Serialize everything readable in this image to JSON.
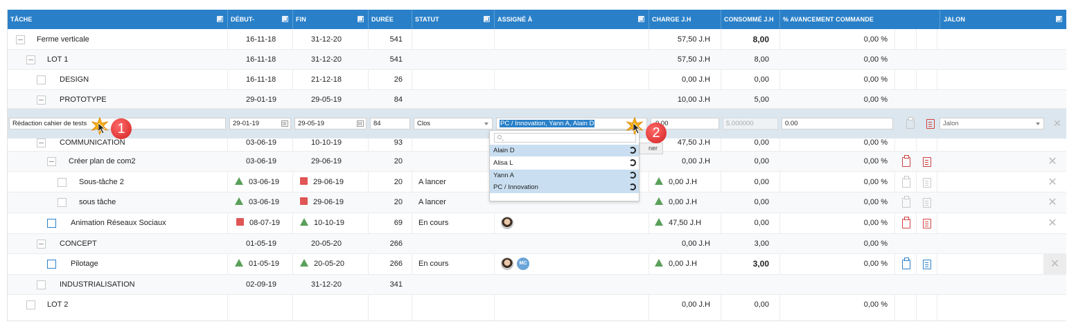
{
  "columns": {
    "task": "TÂCHE",
    "start": "DÉBUT-",
    "end": "FIN",
    "duration": "DURÉE",
    "status": "STATUT",
    "assigned": "ASSIGNÉ À",
    "charge": "CHARGE J.H",
    "consumed": "CONSOMMÉ J.H",
    "progress": "% AVANCEMENT COMMANDE",
    "milestone": "JALON"
  },
  "rows_top": [
    {
      "task": "Ferme verticale",
      "start": "16-11-18",
      "end": "31-12-20",
      "duration": "541",
      "charge": "57,50 J.H",
      "consumed": "8,00",
      "progress": "0,00 %"
    },
    {
      "task": "LOT 1",
      "start": "16-11-18",
      "end": "31-12-20",
      "duration": "541",
      "charge": "57,50 J.H",
      "consumed": "8,00",
      "progress": "0,00 %"
    },
    {
      "task": "DESIGN",
      "start": "16-11-18",
      "end": "21-12-18",
      "duration": "26",
      "charge": "0,00 J.H",
      "consumed": "0,00",
      "progress": "0,00 %"
    },
    {
      "task": "PROTOTYPE",
      "start": "29-01-19",
      "end": "29-05-19",
      "duration": "84",
      "charge": "10,00 J.H",
      "consumed": "5,00",
      "progress": "0,00 %"
    }
  ],
  "edit_row": {
    "task": "Rédaction cahier de tests",
    "start": "29-01-19",
    "end": "29-05-19",
    "duration": "84",
    "status": "Clos",
    "assigned": "PC / Innovation, Yann A, Alain D",
    "charge": "0,00",
    "consumed": "5.000000",
    "progress": "0.00",
    "milestone": "Jalon"
  },
  "rows_bottom": [
    {
      "task": "COMMUNICATION",
      "start": "03-06-19",
      "end": "10-10-19",
      "duration": "93",
      "status": "",
      "charge": "47,50 J.H",
      "consumed": "0,00",
      "progress": "0,00 %"
    },
    {
      "task": "Créer plan de com2",
      "start": "03-06-19",
      "end": "29-06-19",
      "duration": "20",
      "status": "",
      "charge": "0,00 J.H",
      "consumed": "0,00",
      "progress": "0,00 %"
    },
    {
      "task": "Sous-tâche 2",
      "start": "03-06-19",
      "end": "29-06-19",
      "duration": "20",
      "status": "A lancer",
      "charge": "0,00 J.H",
      "consumed": "0,00",
      "progress": "0,00 %"
    },
    {
      "task": "sous tâche",
      "start": "03-06-19",
      "end": "29-06-19",
      "duration": "20",
      "status": "A lancer",
      "charge": "0,00 J.H",
      "consumed": "0,00",
      "progress": "0,00 %"
    },
    {
      "task": "Animation Réseaux Sociaux",
      "start": "08-07-19",
      "end": "10-10-19",
      "duration": "69",
      "status": "En cours",
      "charge": "47,50 J.H",
      "consumed": "0,00",
      "progress": "0,00 %"
    },
    {
      "task": "CONCEPT",
      "start": "01-05-19",
      "end": "20-05-20",
      "duration": "266",
      "status": "",
      "charge": "0,00 J.H",
      "consumed": "3,00",
      "progress": "0,00 %"
    },
    {
      "task": "Pilotage",
      "start": "01-05-19",
      "end": "20-05-20",
      "duration": "266",
      "status": "En cours",
      "charge": "0,00 J.H",
      "consumed": "3,00",
      "progress": "0,00 %"
    },
    {
      "task": "INDUSTRIALISATION",
      "start": "02-09-19",
      "end": "31-12-20",
      "duration": "341",
      "status": "",
      "charge": "",
      "consumed": "",
      "progress": ""
    },
    {
      "task": "LOT 2",
      "start": "",
      "end": "",
      "duration": "",
      "status": "",
      "charge": "0,00 J.H",
      "consumed": "0,00",
      "progress": "0,00 %"
    }
  ],
  "dropdown": {
    "options": [
      "Alain D",
      "Alisa L",
      "Yann A",
      "PC / Innovation"
    ],
    "tooltip_fragment": "ner"
  },
  "avatar_initials": "MC",
  "markers": [
    "1",
    "2"
  ],
  "colors": {
    "header": "#2a80c8",
    "on_track": "#5aa05a",
    "late": "#e05555"
  }
}
